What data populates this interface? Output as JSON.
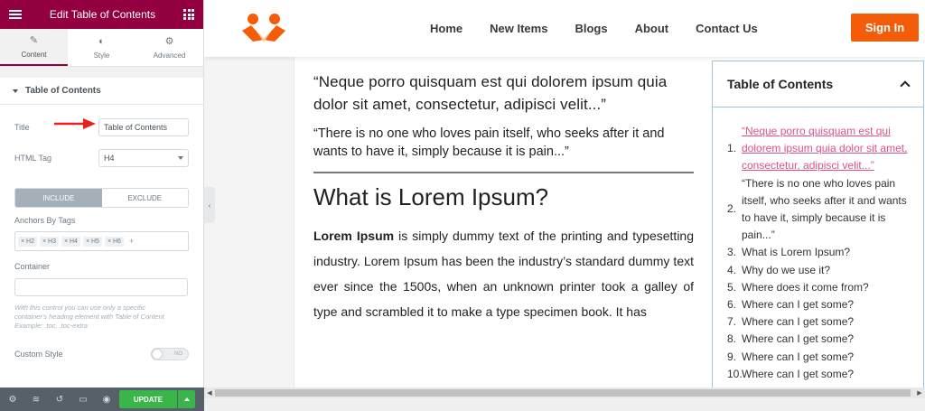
{
  "panel": {
    "title": "Edit Table of Contents",
    "tabs": [
      {
        "label": "Content",
        "icon": "pencil-icon"
      },
      {
        "label": "Style",
        "icon": "half-circle-icon"
      },
      {
        "label": "Advanced",
        "icon": "gear-icon"
      }
    ],
    "section_title": "Table of Contents",
    "title_label": "Title",
    "title_value": "Table of Contents",
    "html_tag_label": "HTML Tag",
    "html_tag_value": "H4",
    "include_label": "INCLUDE",
    "exclude_label": "EXCLUDE",
    "anchors_label": "Anchors By Tags",
    "anchor_tags": [
      "× H2",
      "× H3",
      "× H4",
      "× H5",
      "× H6"
    ],
    "add_tag": "+",
    "container_label": "Container",
    "container_help": "With this control you can use only a specific container's heading element with Table of Content",
    "container_example": "Example: .toc, .toc-extra",
    "custom_style_label": "Custom Style",
    "toggle_label": "NO",
    "update_label": "UPDATE",
    "accent": "#93003f",
    "update_color": "#39b54a"
  },
  "site": {
    "nav": [
      "Home",
      "New Items",
      "Blogs",
      "About",
      "Contact Us"
    ],
    "signin": "Sign In",
    "brand_color": "#f35c08",
    "quote1": "“Neque porro quisquam est qui dolorem ipsum quia dolor sit amet, consectetur, adipisci velit...”",
    "quote2": "“There is no one who loves pain itself, who seeks after it and wants to have it, simply because it is pain...”",
    "heading": "What is Lorem Ipsum?",
    "para_bold": "Lorem Ipsum",
    "para_rest": " is simply dummy text of the printing and typesetting industry. Lorem Ipsum has been the industry’s standard dummy text ever since the 1500s, when an unknown printer took a galley of type and scrambled it to make a type specimen book. It has",
    "toc": {
      "title": "Table of Contents",
      "items": [
        "“Neque porro quisquam est qui dolorem ipsum quia dolor sit amet, consectetur, adipisci velit...”",
        "“There is no one who loves pain itself, who seeks after it and wants to have it, simply because it is pain...”",
        "What is Lorem Ipsum?",
        "Why do we use it?",
        "Where does it come from?",
        "Where can I get some?",
        "Where can I get some?",
        "Where can I get some?",
        "Where can I get some?",
        "Where can I get some?"
      ],
      "numbers": [
        "1.",
        "2.",
        "3.",
        "4.",
        "5.",
        "6.",
        "7.",
        "8.",
        "9.",
        "10."
      ]
    }
  }
}
